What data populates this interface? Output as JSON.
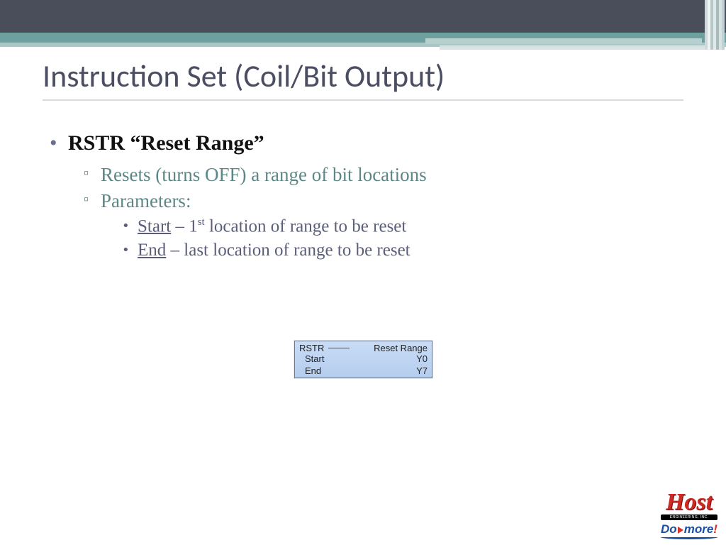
{
  "title": "Instruction Set (Coil/Bit Output)",
  "bullet": {
    "main": "RSTR “Reset Range”",
    "sub1": "Resets (turns OFF) a range of bit locations",
    "sub2": "Parameters:",
    "p_start_label": "Start",
    "p_start_sep": " – 1",
    "p_start_sup": "st",
    "p_start_rest": " location of range to be reset",
    "p_end_label": "End",
    "p_end_rest": " – last location of range to be reset"
  },
  "ibox": {
    "mnemonic": "RSTR",
    "name": "Reset Range",
    "rows": [
      {
        "label": "Start",
        "value": "Y0"
      },
      {
        "label": "End",
        "value": "Y7"
      }
    ]
  },
  "logo": {
    "host": "Host",
    "band": "ENGINEERING, INC.",
    "do": "Do",
    "more": "more",
    "ex": "!"
  }
}
